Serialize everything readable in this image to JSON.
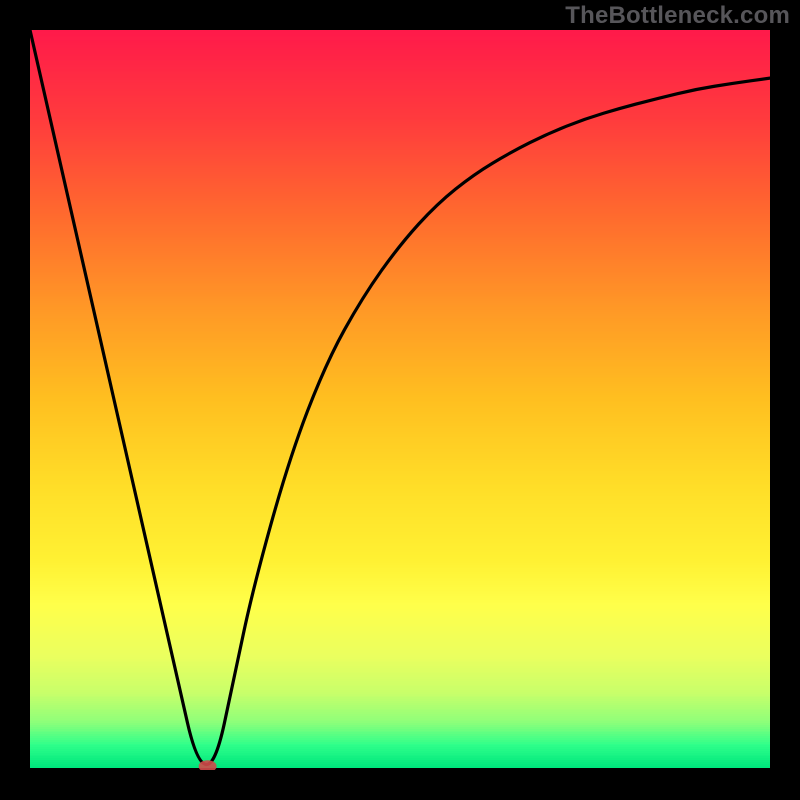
{
  "watermark": "TheBottleneck.com",
  "chart_data": {
    "type": "line",
    "title": "",
    "xlabel": "",
    "ylabel": "",
    "xlim": [
      0,
      100
    ],
    "ylim": [
      0,
      100
    ],
    "gradient_stops": [
      {
        "pct": 0.0,
        "color": "#ff1a4a"
      },
      {
        "pct": 0.12,
        "color": "#ff3b3d"
      },
      {
        "pct": 0.25,
        "color": "#ff6a2e"
      },
      {
        "pct": 0.38,
        "color": "#ff9926"
      },
      {
        "pct": 0.5,
        "color": "#ffbf20"
      },
      {
        "pct": 0.62,
        "color": "#ffde28"
      },
      {
        "pct": 0.72,
        "color": "#fff133"
      },
      {
        "pct": 0.78,
        "color": "#ffff4a"
      },
      {
        "pct": 0.85,
        "color": "#eaff5f"
      },
      {
        "pct": 0.9,
        "color": "#c8ff6a"
      },
      {
        "pct": 0.94,
        "color": "#8dff7a"
      },
      {
        "pct": 0.97,
        "color": "#30ff8a"
      },
      {
        "pct": 1.0,
        "color": "#00e77d"
      }
    ],
    "series": [
      {
        "name": "bottleneck-curve",
        "x": [
          0.0,
          2.5,
          5.0,
          7.5,
          10.0,
          12.5,
          15.0,
          17.5,
          20.0,
          22.5,
          25.0,
          27.5,
          30.0,
          35.0,
          40.0,
          45.0,
          50.0,
          55.0,
          60.0,
          65.0,
          70.0,
          75.0,
          80.0,
          85.0,
          90.0,
          95.0,
          100.0
        ],
        "y": [
          100.0,
          89.0,
          78.0,
          67.0,
          56.0,
          45.0,
          34.0,
          23.0,
          12.0,
          1.0,
          0.5,
          12.0,
          24.0,
          42.0,
          55.0,
          64.0,
          71.0,
          76.5,
          80.5,
          83.5,
          86.0,
          88.0,
          89.5,
          90.8,
          92.0,
          92.8,
          93.5
        ]
      }
    ],
    "marker": {
      "x": 24.0,
      "y": 0.5,
      "color": "#d14a4a"
    }
  }
}
